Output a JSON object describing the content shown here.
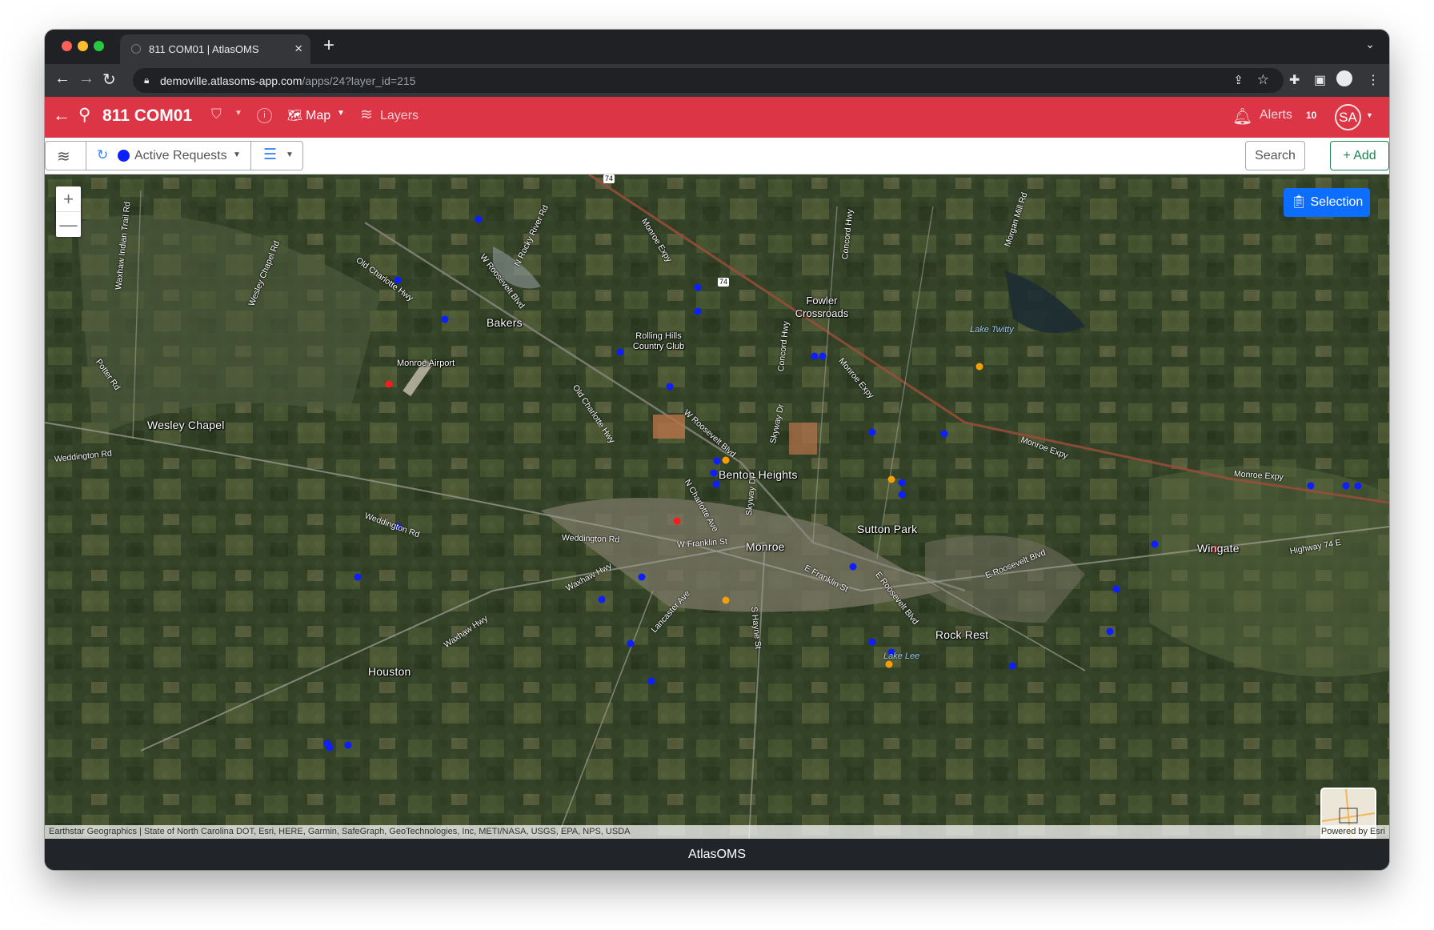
{
  "browser": {
    "tab_title": "811 COM01 | AtlasOMS",
    "url_host": "demoville.atlasoms-app.com",
    "url_path": "/apps/24?layer_id=215"
  },
  "header": {
    "title": "811 COM01",
    "map_label": "Map",
    "layers_label": "Layers",
    "alerts_label": "Alerts",
    "alerts_count": "10",
    "avatar_initials": "SA",
    "background_color": "#dc3545"
  },
  "filterbar": {
    "layer_label": "Active Requests",
    "layer_color": "#0d1fff",
    "search_label": "Search",
    "add_label": "+ Add"
  },
  "map": {
    "selection_label": "Selection",
    "zoom_in": "+",
    "zoom_out": "—",
    "attribution": "Earthstar Geographics | State of North Carolina DOT, Esri, HERE, Garmin, SafeGraph, GeoTechnologies, Inc, METI/NASA, USGS, EPA, NPS, USDA",
    "powered_by": "Powered by Esri",
    "places": [
      "Bakers",
      "Wesley Chapel",
      "Fowler Crossroads",
      "Benton Heights",
      "Sutton Park",
      "Monroe",
      "Wingate",
      "Rock Rest",
      "Houston",
      "Rolling Hills Country Club",
      "Monroe Airport"
    ],
    "water": [
      "Lake Twitty",
      "Lake Lee"
    ],
    "roads": [
      "Old Charlotte Hwy",
      "W Roosevelt Blvd",
      "N Rocky River Rd",
      "Monroe Expy",
      "Concord Hwy",
      "Morgan Mill Rd",
      "Waxhaw Indian Trail Rd",
      "Wesley Chapel Rd",
      "Potter Rd",
      "Weddington Rd",
      "Old Charlotte Hwy",
      "W Roosevelt Blvd",
      "Skyway Dr",
      "N Charlotte Ave",
      "Skyway Dr",
      "Weddington Rd",
      "W Franklin St",
      "E Franklin St",
      "E Roosevelt Blvd",
      "E Roosevelt Blvd",
      "Waxhaw Hwy",
      "Waxhaw Hwy",
      "Lancaster Ave",
      "S Hayne St",
      "Highway 74 E",
      "Monroe Expy",
      "Monroe Expy",
      "Concord Hwy",
      "Monroe Expy",
      "Weddington Rd"
    ],
    "shields": [
      "74",
      "74"
    ],
    "marker_colors": {
      "active": "#0d1fff",
      "warning": "#f59e0b",
      "emergency": "#ff1a1a"
    }
  },
  "footer": {
    "label": "AtlasOMS"
  }
}
